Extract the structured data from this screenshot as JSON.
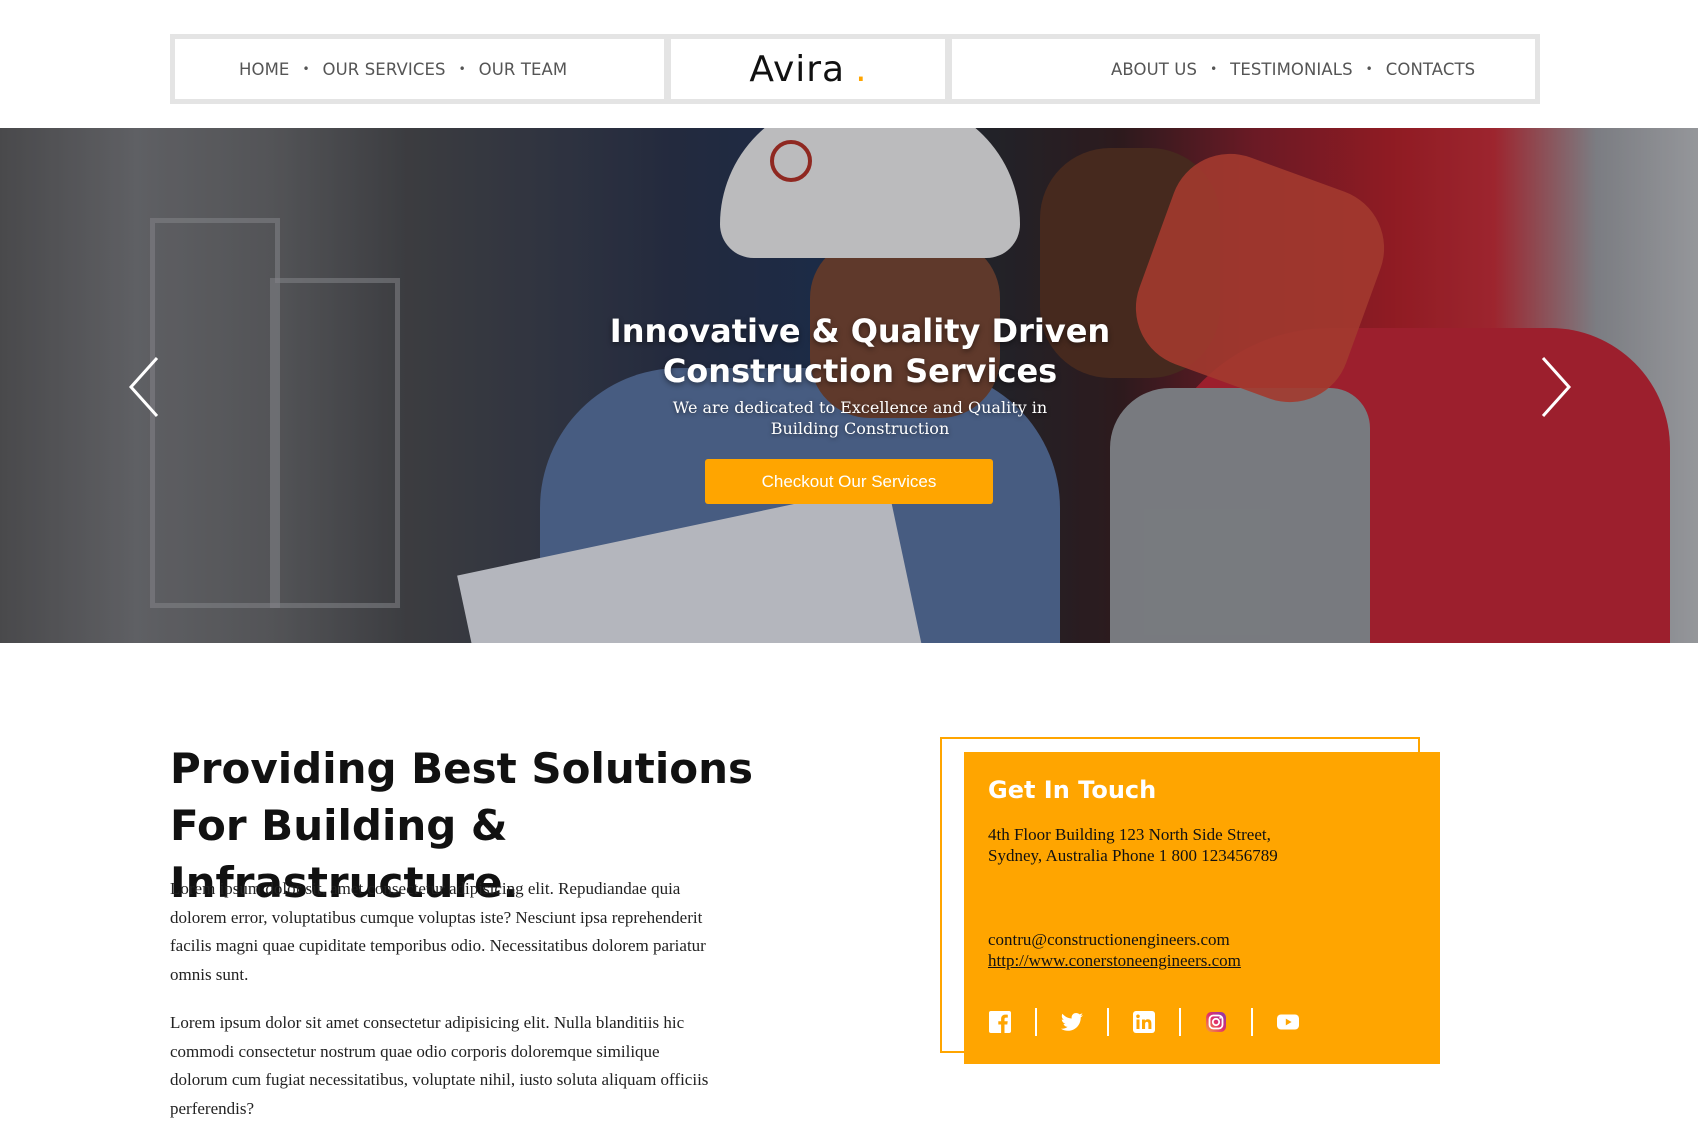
{
  "nav": {
    "left": [
      "HOME",
      "OUR SERVICES",
      "OUR TEAM"
    ],
    "right": [
      "ABOUT US",
      "TESTIMONIALS",
      "CONTACTS"
    ],
    "separator": "•"
  },
  "logo": {
    "text": "Avira",
    "dot": "."
  },
  "hero": {
    "title": "Innovative & Quality Driven Construction Services",
    "subtitle": "We are dedicated to Excellence and Quality in Building Construction",
    "button": "Checkout Our Services",
    "prev_icon": "chevron-left-icon",
    "next_icon": "chevron-right-icon"
  },
  "about": {
    "title": "Providing Best Solutions For Building & Infrastructure.",
    "paragraph1": "Lorem ipsum dolor sit, amet consectetur adipisicing elit. Repudiandae quia dolorem error, voluptatibus cumque voluptas iste? Nesciunt ipsa reprehenderit facilis magni quae cupiditate temporibus odio. Necessitatibus dolorem pariatur omnis sunt.",
    "paragraph2": "Lorem ipsum dolor sit amet consectetur adipisicing elit. Nulla blanditiis hic commodi consectetur nostrum quae odio corporis doloremque similique dolorum cum fugiat necessitatibus, voluptate nihil, iusto soluta aliquam officiis perferendis?"
  },
  "contact": {
    "title": "Get In Touch",
    "address": "4th Floor Building 123 North Side Street, Sydney, Australia Phone 1 800 123456789",
    "email": "contru@constructionengineers.com",
    "website": "http://www.conerstoneengineers.com",
    "social": [
      "facebook-icon",
      "twitter-icon",
      "linkedin-icon",
      "instagram-icon",
      "youtube-icon"
    ]
  },
  "colors": {
    "accent": "#ffa500",
    "nav_text": "#555555",
    "border": "#e4e4e4"
  }
}
